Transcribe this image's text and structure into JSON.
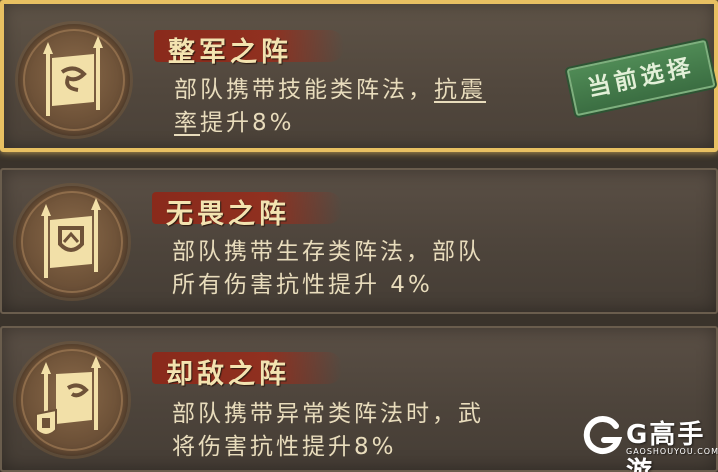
{
  "formations": [
    {
      "title": "整军之阵",
      "desc_before": "部队携带技能类阵法，",
      "desc_underlined_1": "抗震",
      "desc_line2_underlined": "率",
      "desc_after": "提升8%",
      "emblem_icon": "banner-flag-icon",
      "selected": true,
      "badge_label": "当前选择"
    },
    {
      "title": "无畏之阵",
      "desc_line1": "部队携带生存类阵法，部队",
      "desc_line2": "所有伤害抗性提升 4%",
      "emblem_icon": "banner-shield-icon",
      "selected": false
    },
    {
      "title": "却敌之阵",
      "desc_line1": "部队携带异常类阵法时，武",
      "desc_line2": "将伤害抗性提升8%",
      "emblem_icon": "banner-helmet-icon",
      "selected": false
    }
  ],
  "watermark": {
    "brand": "G高手游",
    "url": "GAOSHOUYOU.COM"
  },
  "colors": {
    "selected_border": "#e8c062",
    "title_banner": "#963a22",
    "badge_green": "#4f8a55"
  }
}
